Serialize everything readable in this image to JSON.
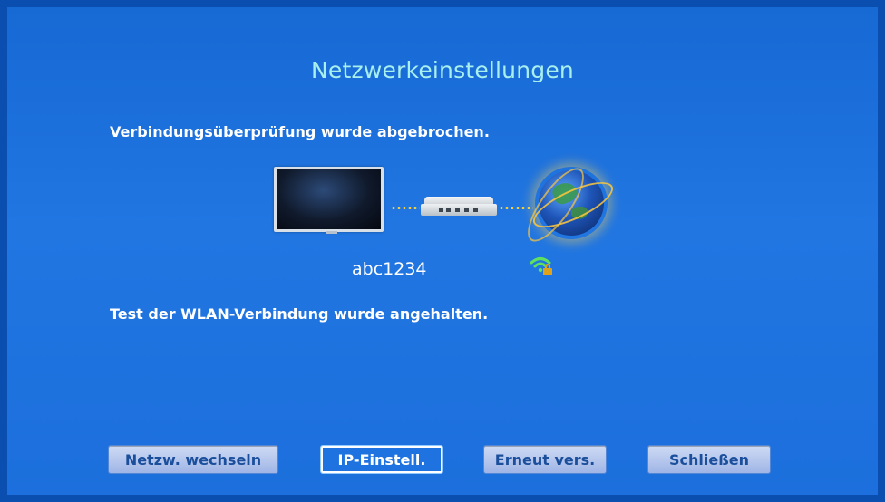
{
  "dialog": {
    "title": "Netzwerkeinstellungen",
    "status_message": "Verbindungsüberprüfung wurde abgebrochen.",
    "wlan_message": "Test der WLAN-Verbindung wurde angehalten.",
    "network_name": "abc1234"
  },
  "icons": {
    "tv": "tv-icon",
    "router": "router-icon",
    "globe": "internet-globe-icon",
    "wifi": "wifi-secured-icon"
  },
  "colors": {
    "background": "#1c6fdc",
    "title": "#a8f0ee",
    "button_text": "#1b4f9c",
    "focused_button": "#1f73e0",
    "connector_dots": "#ffd330",
    "wifi_signal": "#5fe05f",
    "lock": "#e0a21a"
  },
  "buttons": [
    {
      "label": "Netzw. wechseln",
      "focused": false
    },
    {
      "label": "IP-Einstell.",
      "focused": true
    },
    {
      "label": "Erneut vers.",
      "focused": false
    },
    {
      "label": "Schließen",
      "focused": false
    }
  ]
}
